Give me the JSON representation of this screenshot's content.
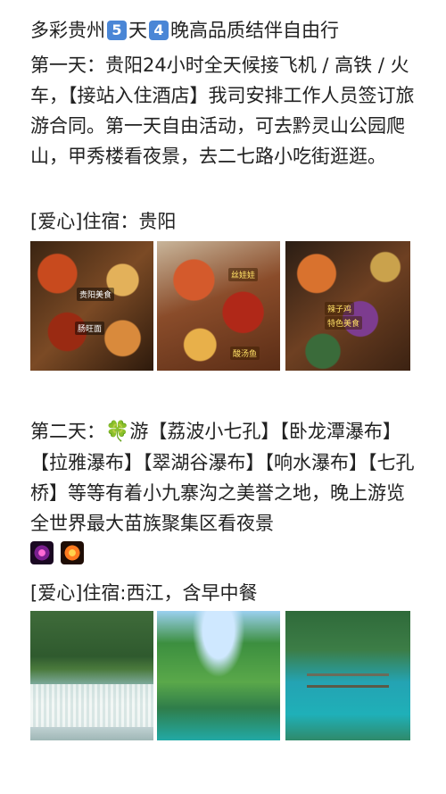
{
  "title": {
    "prefix": "多彩贵州",
    "days": "5",
    "day_word": "天",
    "nights": "4",
    "suffix": "晚高品质结伴自由行"
  },
  "day1": {
    "text": "第一天：贵阳24小时全天候接飞机 / 高铁 / 火车，【接站入住酒店】我司安排工作人员签订旅游合同。第一天自由活动，可去黔灵山公园爬山，甲秀楼看夜景，去二七路小吃街逛逛。",
    "stay": "[爱心]住宿：贵阳",
    "photo_tags": [
      "贵阳美食",
      "肠旺面",
      "丝娃娃",
      "酸汤鱼",
      "辣子鸡",
      "特色美食"
    ]
  },
  "day2": {
    "prefix": "第二天：",
    "clover": "🍀",
    "text": "游【荔波小七孔】【卧龙潭瀑布】【拉雅瀑布】【翠湖谷瀑布】【响水瀑布】【七孔桥】等等有着小九寨沟之美誉之地，晚上游览全世界最大苗族聚集区看夜景",
    "emoji_1": "🎆",
    "emoji_2": "🎇",
    "stay": "[爱心]住宿:西江，含早中餐"
  },
  "colors": {
    "badge": "#4a86d6",
    "text": "#222222",
    "background": "#ffffff"
  }
}
